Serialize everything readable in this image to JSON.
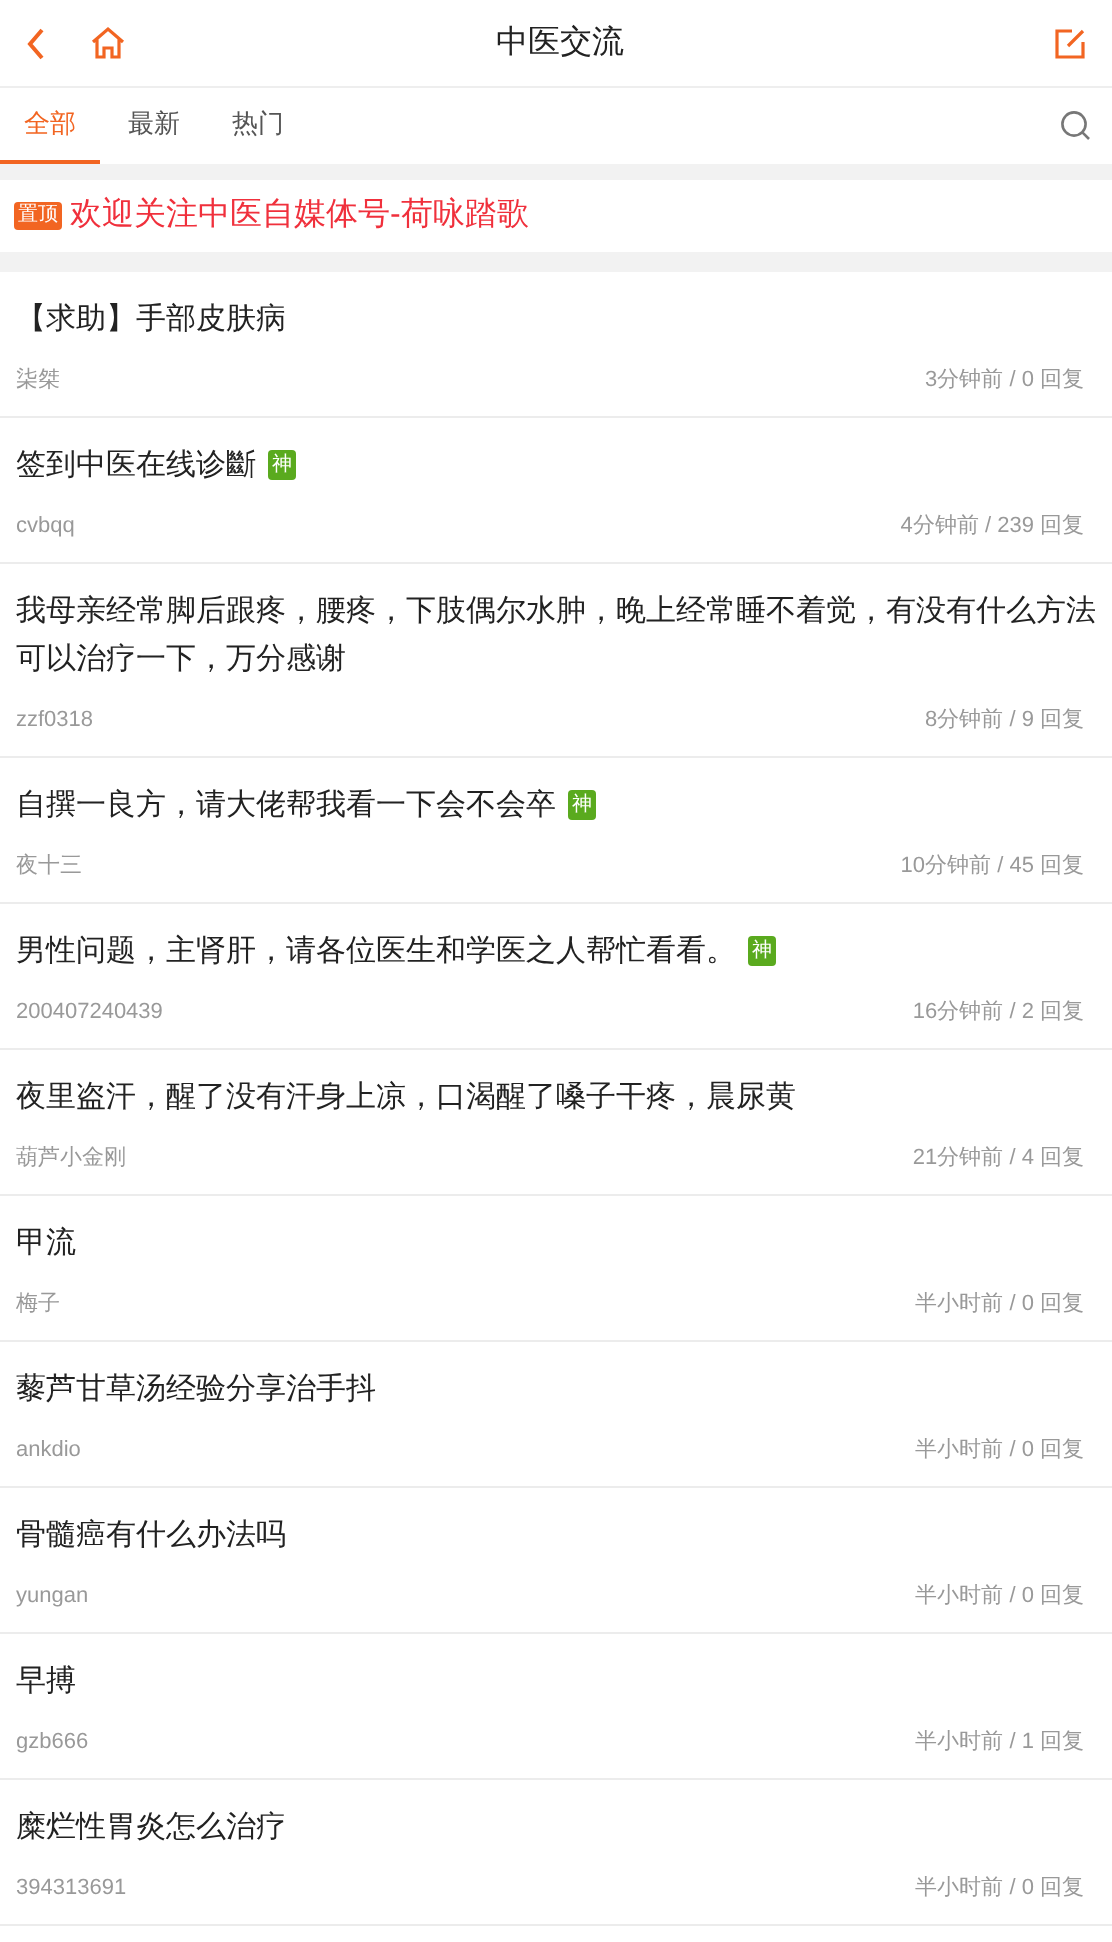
{
  "header": {
    "title": "中医交流"
  },
  "tabs": [
    {
      "label": "全部",
      "selected": true
    },
    {
      "label": "最新",
      "selected": false
    },
    {
      "label": "热门",
      "selected": false
    }
  ],
  "pinned": {
    "badge": "置顶",
    "text": "欢迎关注中医自媒体号-荷咏踏歌"
  },
  "posts": [
    {
      "title": "【求助】手部皮肤病",
      "author": "柒桀",
      "meta": "3分钟前 / 0 回复"
    },
    {
      "title": "签到中医在线诊斷",
      "badge": "神",
      "author": "cvbqq",
      "meta": "4分钟前 / 239 回复"
    },
    {
      "title": "我母亲经常脚后跟疼，腰疼，下肢偶尔水肿，晚上经常睡不着觉，有没有什么方法可以治疗一下，万分感谢",
      "author": "zzf0318",
      "meta": "8分钟前 / 9 回复"
    },
    {
      "title": "自撰一良方，请大佬帮我看一下会不会卒",
      "badge": "神",
      "author": "夜十三",
      "meta": "10分钟前 / 45 回复"
    },
    {
      "title": "男性问题，主肾肝，请各位医生和学医之人帮忙看看。",
      "badge": "神",
      "author": "200407240439",
      "meta": "16分钟前 / 2 回复"
    },
    {
      "title": "夜里盗汗，醒了没有汗身上凉，口渴醒了嗓子干疼，晨尿黄",
      "author": "葫芦小金刚",
      "meta": "21分钟前 / 4 回复"
    },
    {
      "title": "甲流",
      "author": "梅子",
      "meta": "半小时前 / 0 回复"
    },
    {
      "title": "藜芦甘草汤经验分享治手抖",
      "author": "ankdio",
      "meta": "半小时前 / 0 回复"
    },
    {
      "title": "骨髓癌有什么办法吗",
      "author": "yungan",
      "meta": "半小时前 / 0 回复"
    },
    {
      "title": "早搏",
      "author": "gzb666",
      "meta": "半小时前 / 1 回复"
    },
    {
      "title": "糜烂性胃炎怎么治疗",
      "author": "394313691",
      "meta": "半小时前 / 0 回复"
    }
  ]
}
